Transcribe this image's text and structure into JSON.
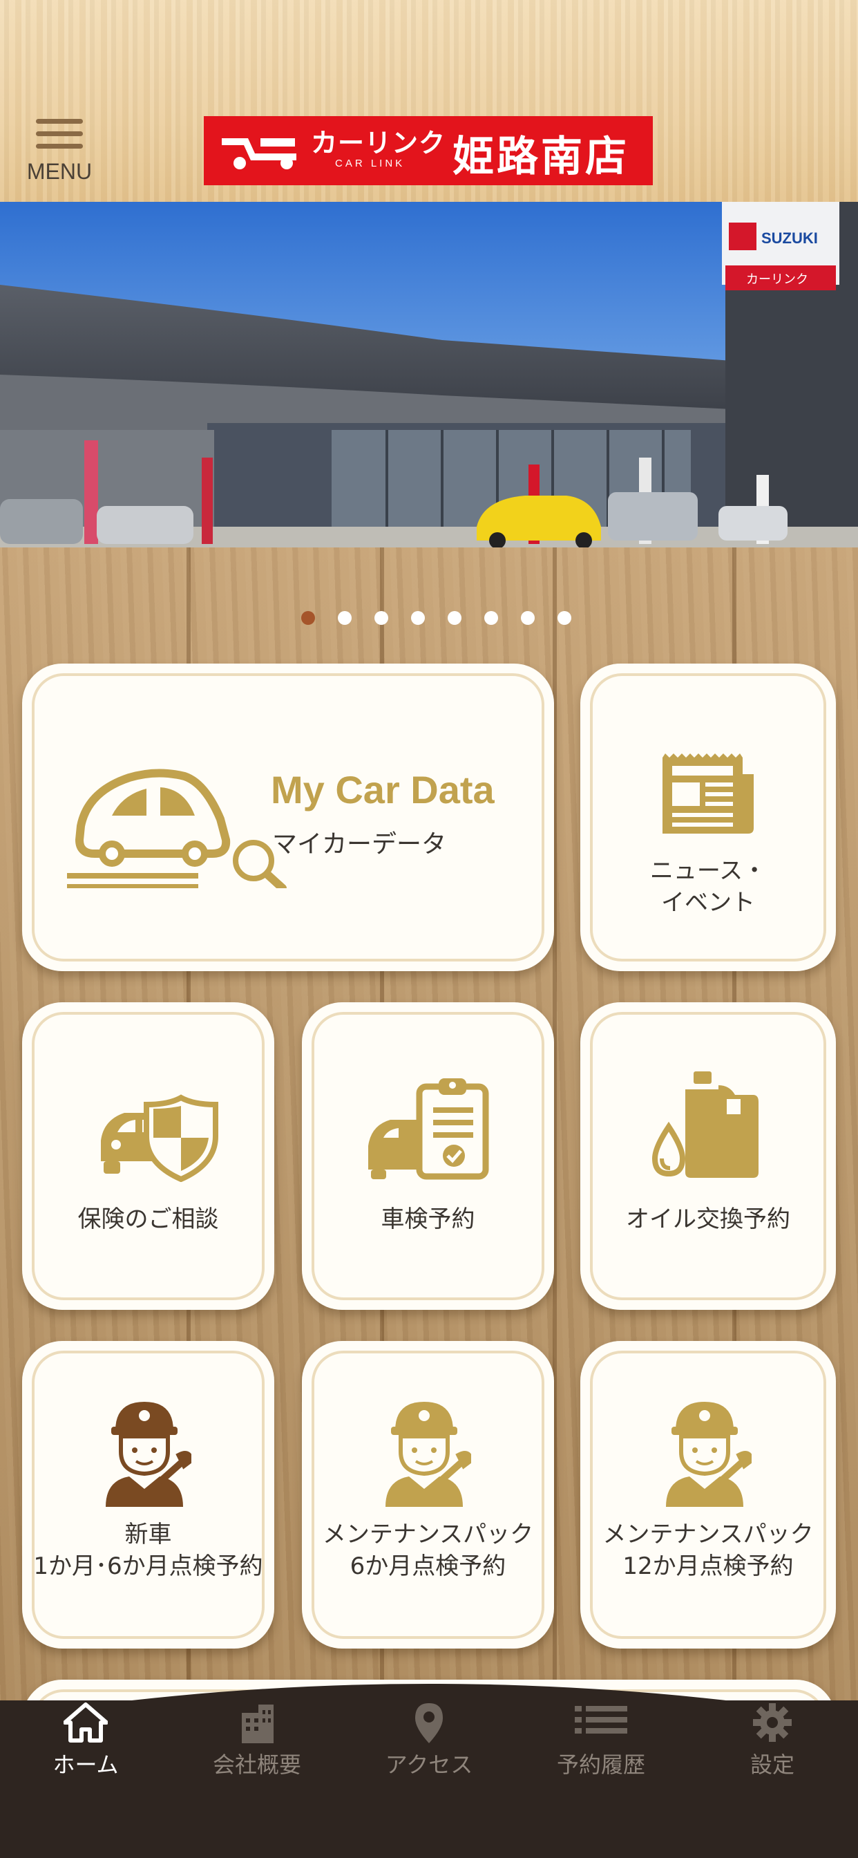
{
  "header": {
    "menu_label": "MENU",
    "logo": {
      "brand": "カーリンク",
      "sub": "CAR LINK",
      "store": "姫路南店",
      "color": "#e3141c"
    }
  },
  "hero": {
    "signs": {
      "brand": "SUZUKI",
      "store_sign": "カーリンク"
    }
  },
  "carousel": {
    "total": 8,
    "active_index": 0
  },
  "tiles": {
    "my_car_data": {
      "title": "My Car Data",
      "subtitle": "マイカーデータ",
      "icon": "car-search-icon"
    },
    "news": {
      "line1": "ニュース・",
      "line2": "イベント",
      "icon": "newspaper-icon"
    },
    "insurance": {
      "label": "保険のご相談",
      "icon": "car-shield-icon"
    },
    "shaken": {
      "label": "車検予約",
      "icon": "car-clipboard-icon"
    },
    "oil": {
      "label": "オイル交換予約",
      "icon": "oil-can-icon"
    },
    "new_car": {
      "line1": "新車",
      "line2": "1か月･6か月点検予約",
      "icon": "mechanic-icon"
    },
    "maint6": {
      "line1": "メンテナンスパック",
      "line2": "6か月点検予約",
      "icon": "mechanic-icon"
    },
    "maint12": {
      "line1": "メンテナンスパック",
      "line2": "12か月点検予約",
      "icon": "mechanic-icon"
    }
  },
  "tabbar": {
    "items": [
      {
        "label": "ホーム",
        "icon": "home-icon",
        "active": true
      },
      {
        "label": "会社概要",
        "icon": "building-icon",
        "active": false
      },
      {
        "label": "アクセス",
        "icon": "location-pin-icon",
        "active": false
      },
      {
        "label": "予約履歴",
        "icon": "list-icon",
        "active": false
      },
      {
        "label": "設定",
        "icon": "gear-icon",
        "active": false
      }
    ]
  },
  "colors": {
    "accent_gold": "#c1a24e",
    "mechanic_brown": "#7a4a22",
    "tabbar_bg": "#2e2520",
    "dot_active": "#a5552a"
  }
}
